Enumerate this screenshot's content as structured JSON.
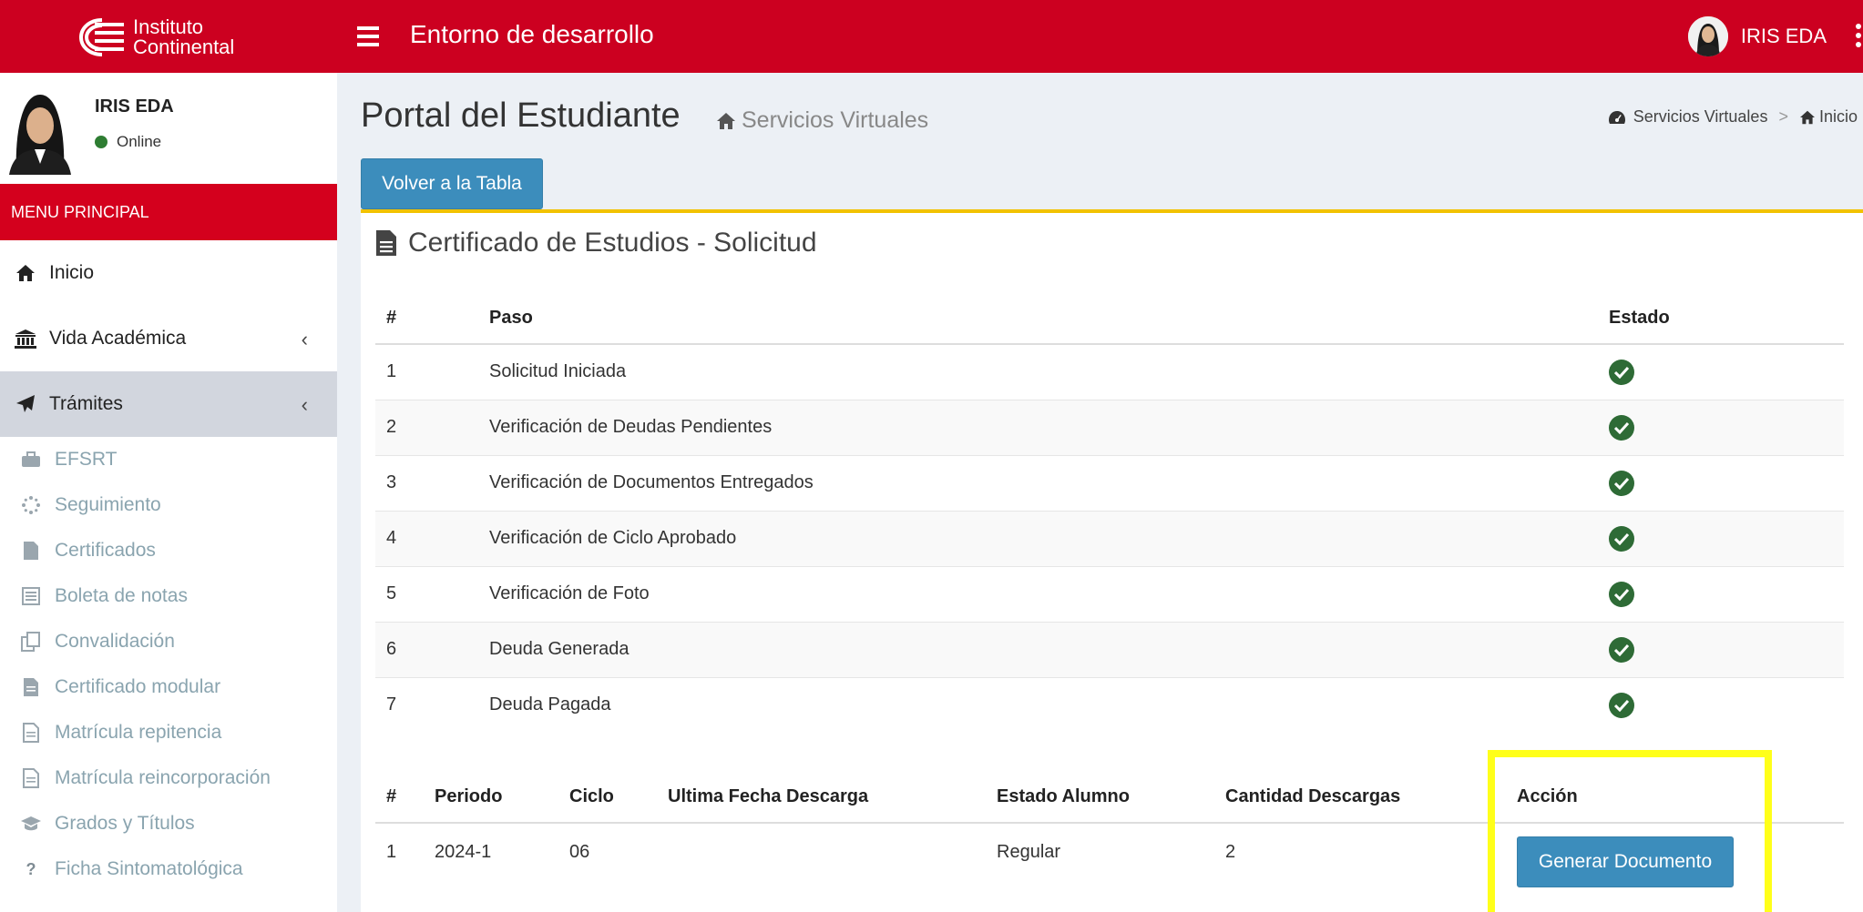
{
  "topbar": {
    "logo_line1": "Instituto",
    "logo_line2": "Continental",
    "app_title": "Entorno de desarrollo",
    "user_name": "IRIS EDA"
  },
  "sidebar": {
    "user_name": "IRIS EDA",
    "status": "Online",
    "menu_header": "MENU PRINCIPAL",
    "items": [
      {
        "label": "Inicio",
        "icon": "home-icon"
      },
      {
        "label": "Vida Académica",
        "icon": "bank-icon"
      },
      {
        "label": "Trámites",
        "icon": "paper-plane-icon"
      }
    ],
    "sub_items": [
      {
        "label": "EFSRT",
        "icon": "briefcase-icon"
      },
      {
        "label": "Seguimiento",
        "icon": "spinner-icon"
      },
      {
        "label": "Certificados",
        "icon": "file-icon"
      },
      {
        "label": "Boleta de notas",
        "icon": "list-alt-icon"
      },
      {
        "label": "Convalidación",
        "icon": "copy-icon"
      },
      {
        "label": "Certificado modular",
        "icon": "file-text-icon"
      },
      {
        "label": "Matrícula repitencia",
        "icon": "file-text-o-icon"
      },
      {
        "label": "Matrícula reincorporación",
        "icon": "file-text-o-icon"
      },
      {
        "label": "Grados y Títulos",
        "icon": "graduation-cap-icon"
      },
      {
        "label": "Ficha Sintomatológica",
        "icon": "question-icon"
      }
    ]
  },
  "content": {
    "page_title": "Portal del Estudiante",
    "page_subtitle": "Servicios Virtuales",
    "breadcrumb": [
      "Servicios Virtuales",
      "Inicio"
    ],
    "back_button": "Volver a la Tabla",
    "box_title": "Certificado de Estudios - Solicitud",
    "steps_headers": [
      "#",
      "Paso",
      "Estado"
    ],
    "steps": [
      {
        "num": "1",
        "paso": "Solicitud Iniciada"
      },
      {
        "num": "2",
        "paso": "Verificación de Deudas Pendientes"
      },
      {
        "num": "3",
        "paso": "Verificación de Documentos Entregados"
      },
      {
        "num": "4",
        "paso": "Verificación de Ciclo Aprobado"
      },
      {
        "num": "5",
        "paso": "Verificación de Foto"
      },
      {
        "num": "6",
        "paso": "Deuda Generada"
      },
      {
        "num": "7",
        "paso": "Deuda Pagada"
      }
    ],
    "downloads_headers": [
      "#",
      "Periodo",
      "Ciclo",
      "Ultima Fecha Descarga",
      "Estado Alumno",
      "Cantidad Descargas",
      "Acción"
    ],
    "downloads_row": {
      "num": "1",
      "periodo": "2024-1",
      "ciclo": "06",
      "ultima_fecha": "",
      "estado": "Regular",
      "cantidad": "2",
      "accion": "Generar Documento"
    }
  },
  "colors": {
    "brand_red": "#cc0020",
    "button_blue": "#3c8dbc",
    "box_accent": "#f2c200",
    "check_green": "#2e6b36",
    "highlight": "#ffff1a"
  }
}
